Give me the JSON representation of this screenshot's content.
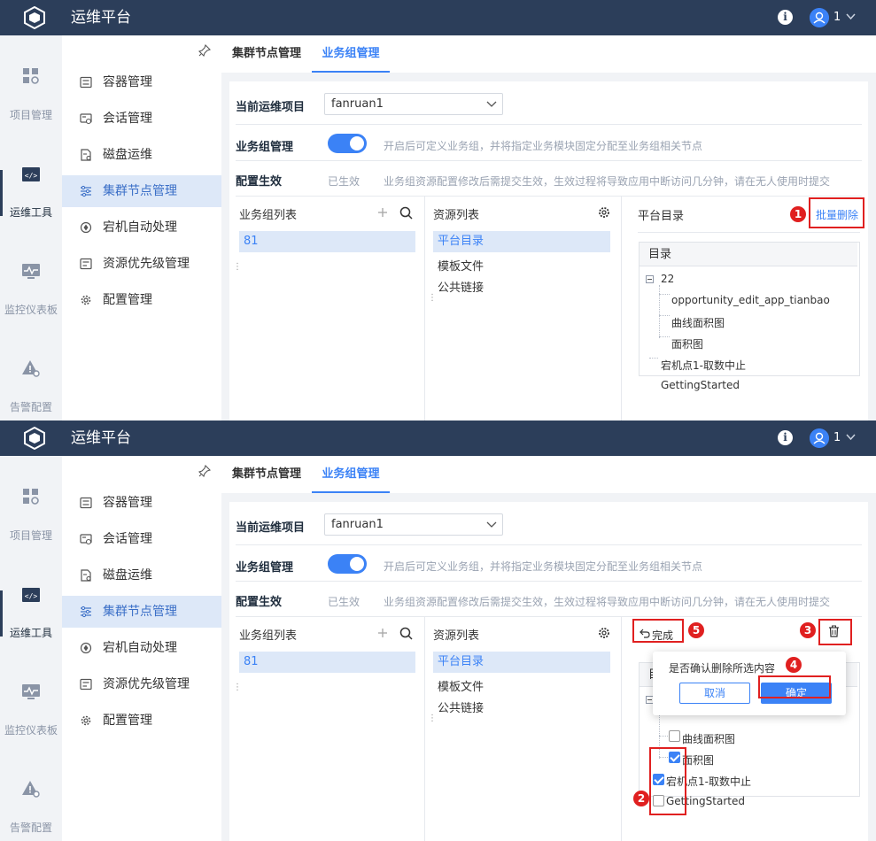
{
  "app": {
    "title": "运维平台",
    "user": "1"
  },
  "leftnav": [
    {
      "label": "项目管理",
      "icon": "grid-icon"
    },
    {
      "label": "运维工具",
      "icon": "code-window-icon"
    },
    {
      "label": "监控仪表板",
      "icon": "pulse-monitor-icon"
    },
    {
      "label": "告警配置",
      "icon": "alert-gear-icon"
    }
  ],
  "subnav": [
    {
      "label": "容器管理",
      "icon": "container-icon"
    },
    {
      "label": "会话管理",
      "icon": "session-icon"
    },
    {
      "label": "磁盘运维",
      "icon": "disk-icon"
    },
    {
      "label": "集群节点管理",
      "icon": "sliders-icon"
    },
    {
      "label": "宕机自动处理",
      "icon": "auto-recover-icon"
    },
    {
      "label": "资源优先级管理",
      "icon": "priority-icon"
    },
    {
      "label": "配置管理",
      "icon": "config-gear-icon"
    }
  ],
  "tabs": [
    {
      "label": "集群节点管理"
    },
    {
      "label": "业务组管理"
    }
  ],
  "form": {
    "project_label": "当前运维项目",
    "project_value": "fanruan1",
    "group_mgmt_label": "业务组管理",
    "group_mgmt_hint": "开启后可定义业务组，并将指定业务模块固定分配至业务组相关节点",
    "config_label": "配置生效",
    "config_status": "已生效",
    "config_hint": "业务组资源配置修改后需提交生效，生效过程将导致应用中断访问几分钟，请在无人使用时提交"
  },
  "groups": {
    "title": "业务组列表",
    "items": [
      "81"
    ]
  },
  "resources": {
    "title": "资源列表",
    "items": [
      "平台目录",
      "模板文件",
      "公共链接"
    ]
  },
  "catalog": {
    "title": "平台目录",
    "batch_delete": "批量删除",
    "done": "完成",
    "tree_header": "目录",
    "tree_header_short": "目",
    "nodes": {
      "n22": "22",
      "opp": "opportunity_edit_app_tianbao",
      "curve": "曲线面积图",
      "area": "面积图",
      "crash": "宕机点1-取数中止",
      "started": "GettingStarted"
    }
  },
  "dialog": {
    "message": "是否确认删除所选内容",
    "cancel": "取消",
    "ok": "确定"
  },
  "badges": [
    "1",
    "2",
    "3",
    "4",
    "5"
  ],
  "colors": {
    "topbar": "#2c3e5a",
    "accent": "#3b82f6",
    "highlight": "#e02020",
    "selected_bg": "#dde8f8"
  }
}
